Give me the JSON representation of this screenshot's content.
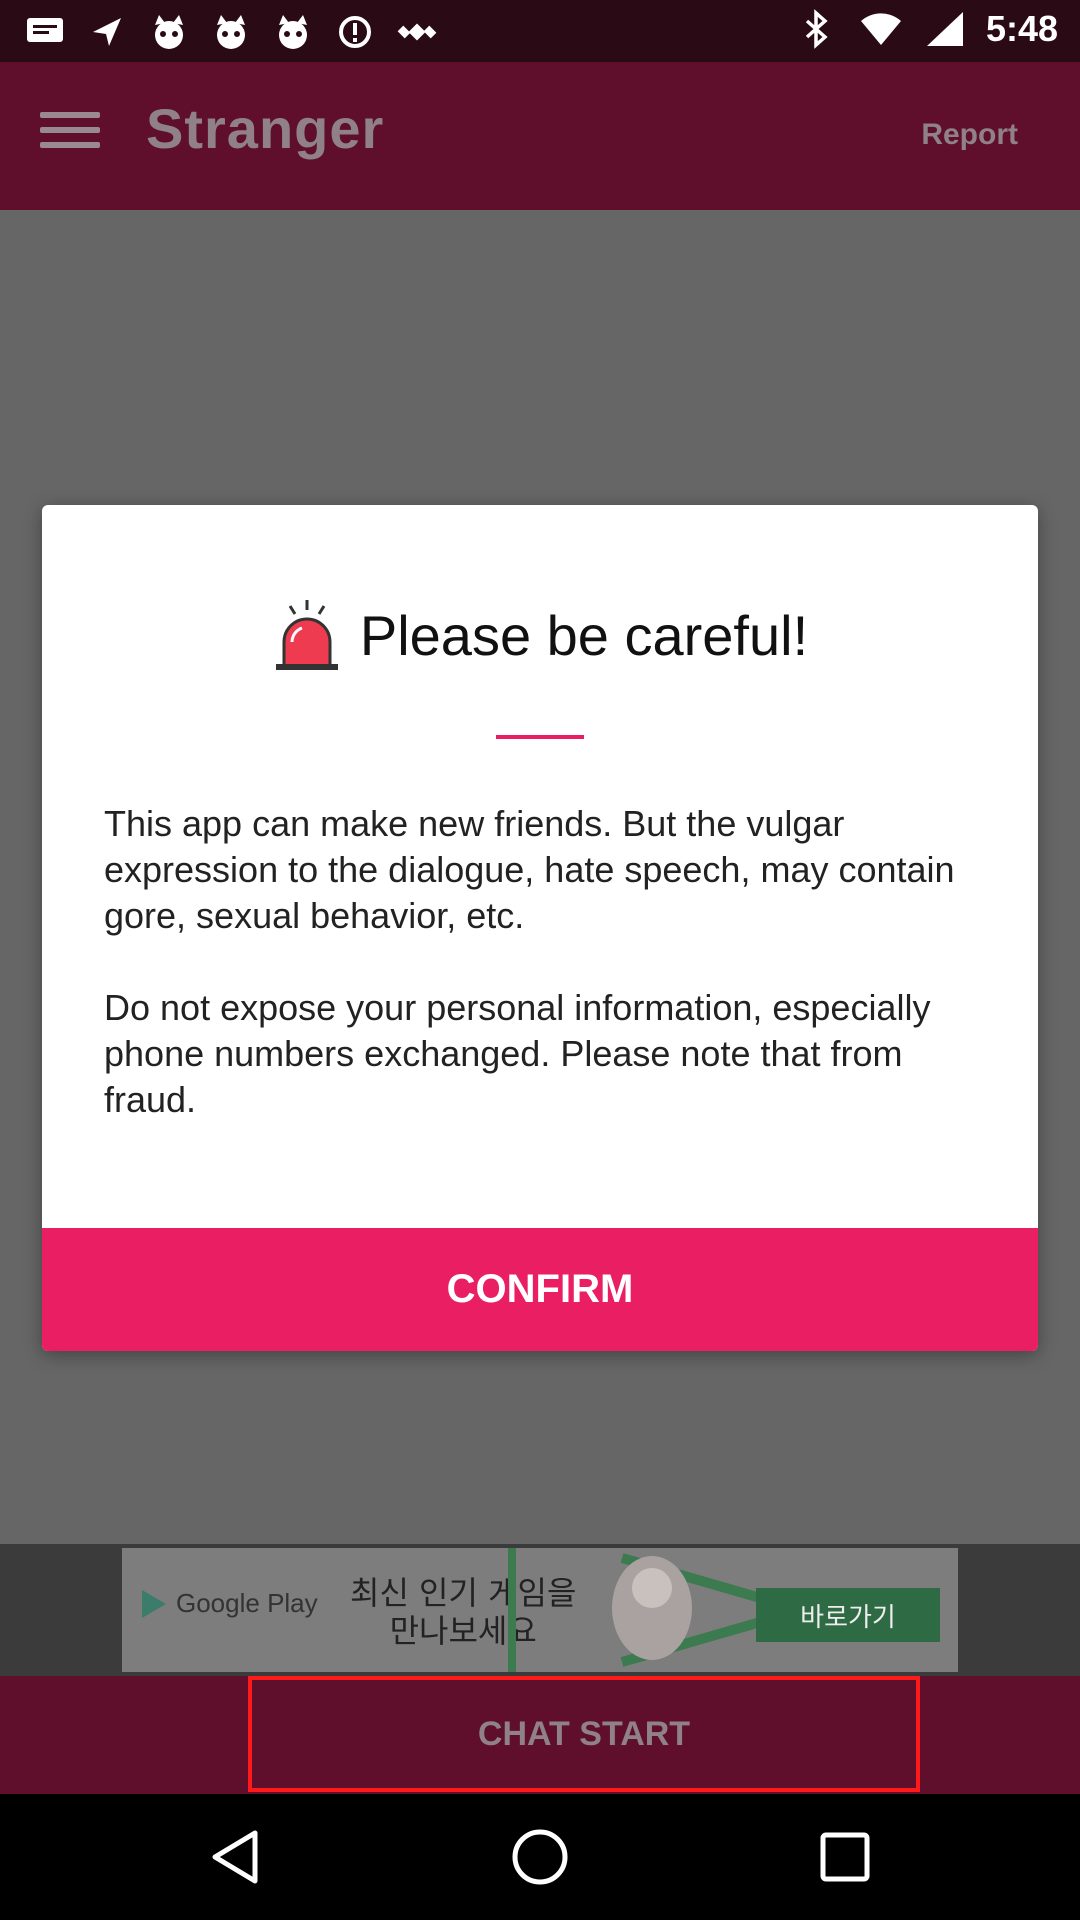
{
  "status_bar": {
    "time": "5:48",
    "left_icons": [
      "message-icon",
      "navigation-icon",
      "mascot-icon",
      "mascot-icon",
      "mascot-icon",
      "fake-gps-icon",
      "satellite-icon"
    ],
    "right_icons": [
      "bluetooth-icon",
      "wifi-icon",
      "cell-signal-icon"
    ]
  },
  "app_bar": {
    "title": "Stranger",
    "report_label": "Report"
  },
  "dialog": {
    "title": "Please be careful!",
    "paragraph1": " This app can make new friends. But the vulgar expression to the dialogue, hate speech, may contain gore, sexual behavior, etc.",
    "paragraph2": " Do not expose your personal information, especially phone numbers exchanged. Please note that from fraud.",
    "confirm_label": "CONFIRM",
    "accent_color": "#e91e63"
  },
  "ad": {
    "store_label": "Google Play",
    "headline": "최신 인기 게임을\n만나보세요",
    "cta_label": "바로가기"
  },
  "bottom": {
    "chat_start_label": "CHAT START"
  },
  "colors": {
    "app_bar": "#5f0f2c",
    "accent": "#e91e63"
  }
}
